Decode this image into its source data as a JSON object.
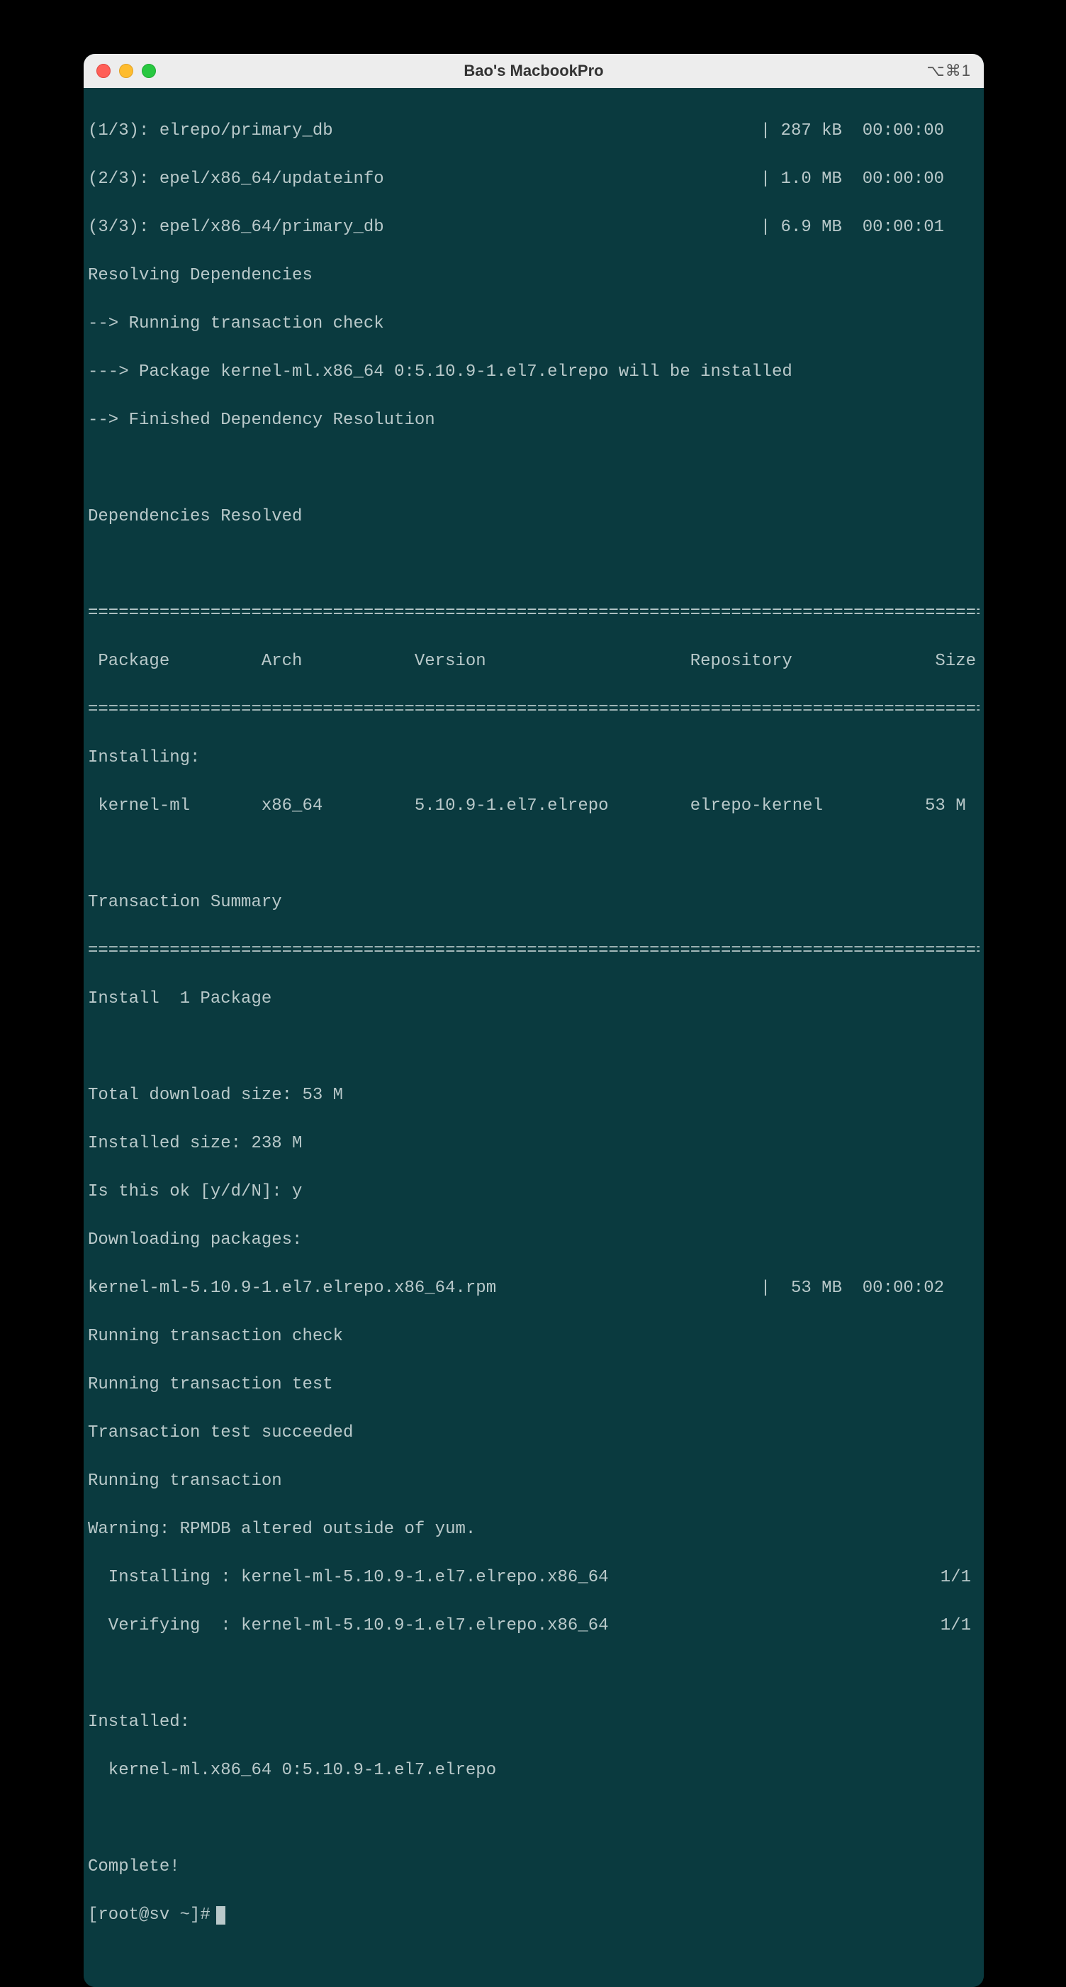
{
  "titlebar": {
    "title": "Bao's MacbookPro",
    "shortcut": "⌥⌘1"
  },
  "downloads": [
    {
      "left": "(1/3): elrepo/primary_db",
      "size": "287 kB",
      "time": "00:00:00"
    },
    {
      "left": "(2/3): epel/x86_64/updateinfo",
      "size": "1.0 MB",
      "time": "00:00:00"
    },
    {
      "left": "(3/3): epel/x86_64/primary_db",
      "size": "6.9 MB",
      "time": "00:00:01"
    }
  ],
  "deps": {
    "resolving": "Resolving Dependencies",
    "check": "--> Running transaction check",
    "pkg": "---> Package kernel-ml.x86_64 0:5.10.9-1.el7.elrepo will be installed",
    "finished": "--> Finished Dependency Resolution",
    "resolved": "Dependencies Resolved"
  },
  "table": {
    "header": " Package         Arch           Version                    Repository              Size",
    "installing": "Installing:",
    "row": " kernel-ml       x86_64         5.10.9-1.el7.elrepo        elrepo-kernel          53 M",
    "row_data": {
      "package": "kernel-ml",
      "arch": "x86_64",
      "version": "5.10.9-1.el7.elrepo",
      "repository": "elrepo-kernel",
      "size": "53 M"
    }
  },
  "summary": {
    "title": "Transaction Summary",
    "install": "Install  1 Package"
  },
  "totals": {
    "download": "Total download size: 53 M",
    "installed": "Installed size: 238 M",
    "confirm": "Is this ok [y/d/N]: y",
    "downloading": "Downloading packages:",
    "rpm_left": "kernel-ml-5.10.9-1.el7.elrepo.x86_64.rpm",
    "rpm_size": "53 MB",
    "rpm_time": "00:00:02"
  },
  "trans": {
    "check": "Running transaction check",
    "test": "Running transaction test",
    "succeeded": "Transaction test succeeded",
    "running": "Running transaction",
    "warning": "Warning: RPMDB altered outside of yum.",
    "installing_left": "  Installing : kernel-ml-5.10.9-1.el7.elrepo.x86_64",
    "installing_right": "1/1",
    "verifying_left": "  Verifying  : kernel-ml-5.10.9-1.el7.elrepo.x86_64",
    "verifying_right": "1/1"
  },
  "tail": {
    "installed": "Installed:",
    "pkg": "  kernel-ml.x86_64 0:5.10.9-1.el7.elrepo",
    "complete": "Complete!",
    "prompt": "[root@sv ~]#"
  },
  "sep": "=================================================================================================="
}
